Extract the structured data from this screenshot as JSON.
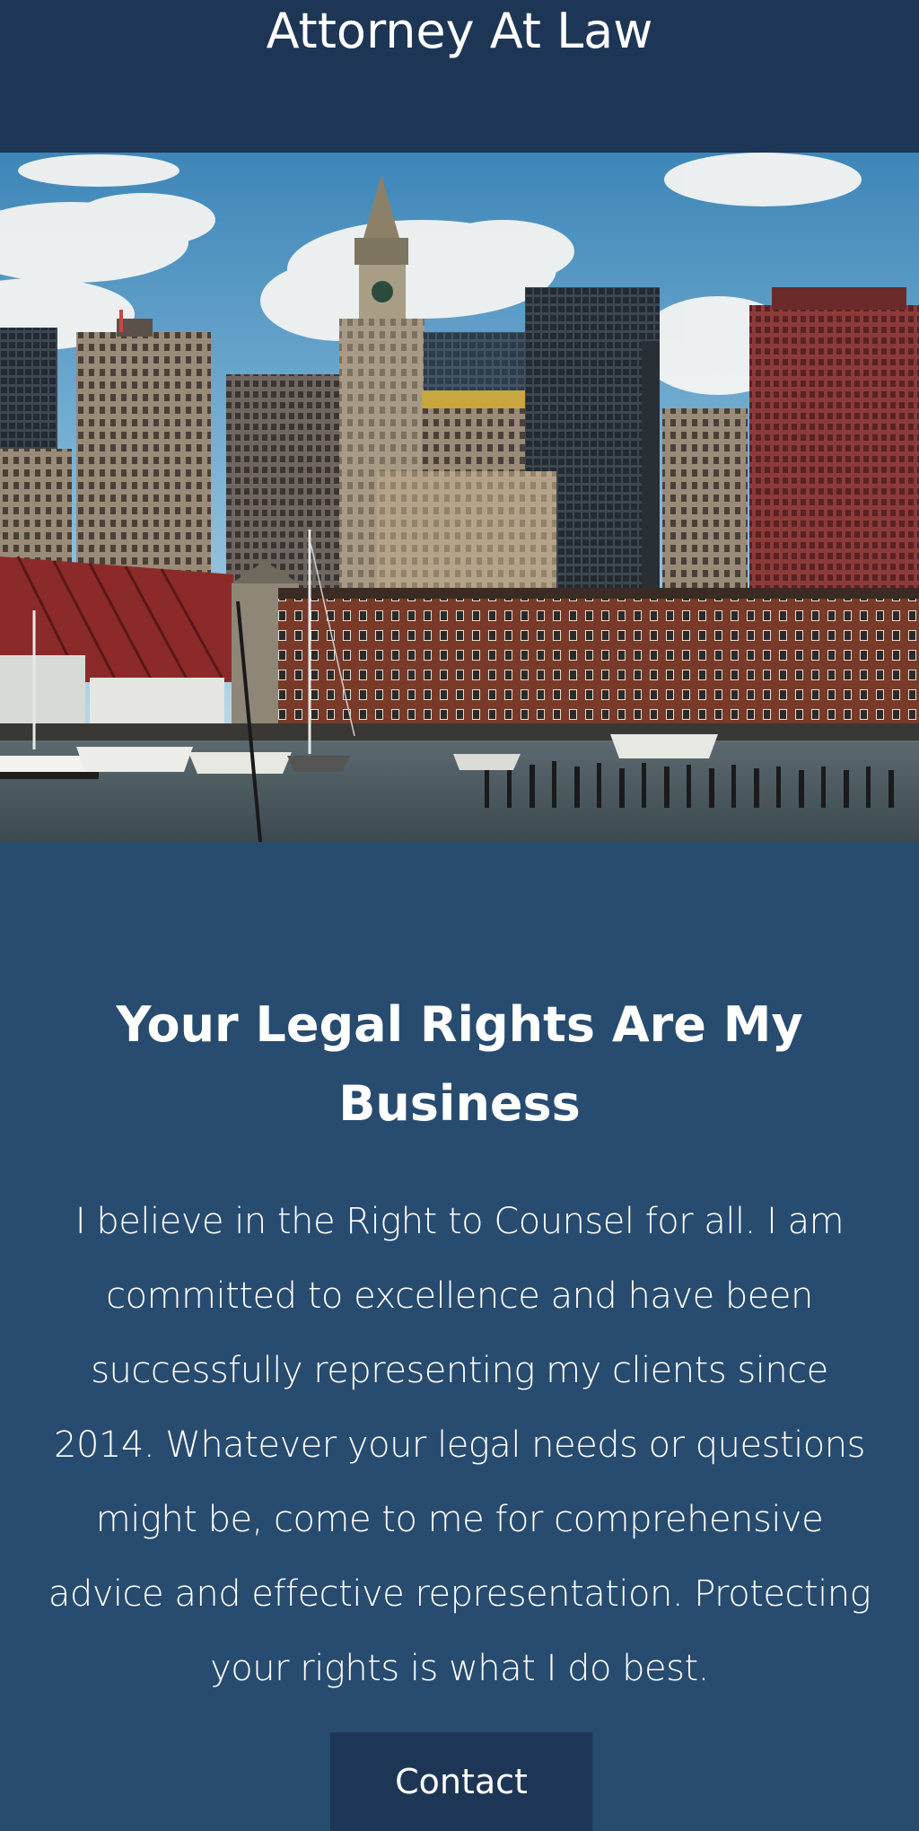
{
  "header": {
    "site_title": "Attorney At Law"
  },
  "hero": {
    "image_icon": "city-skyline-harbor-photo"
  },
  "main": {
    "headline": "Your Legal Rights Are My Business",
    "intro": "I believe in the Right to Counsel for all. I am committed to excellence and have been successfully representing my clients since 2014. Whatever your legal needs or questions might be, come to me for comprehensive advice and effective representation. Protecting your rights is what I do best.",
    "contact_label": "Contact"
  },
  "colors": {
    "header_bg": "#1e3656",
    "content_bg": "#284b70",
    "button_bg": "#1e3656",
    "text": "#ffffff"
  }
}
